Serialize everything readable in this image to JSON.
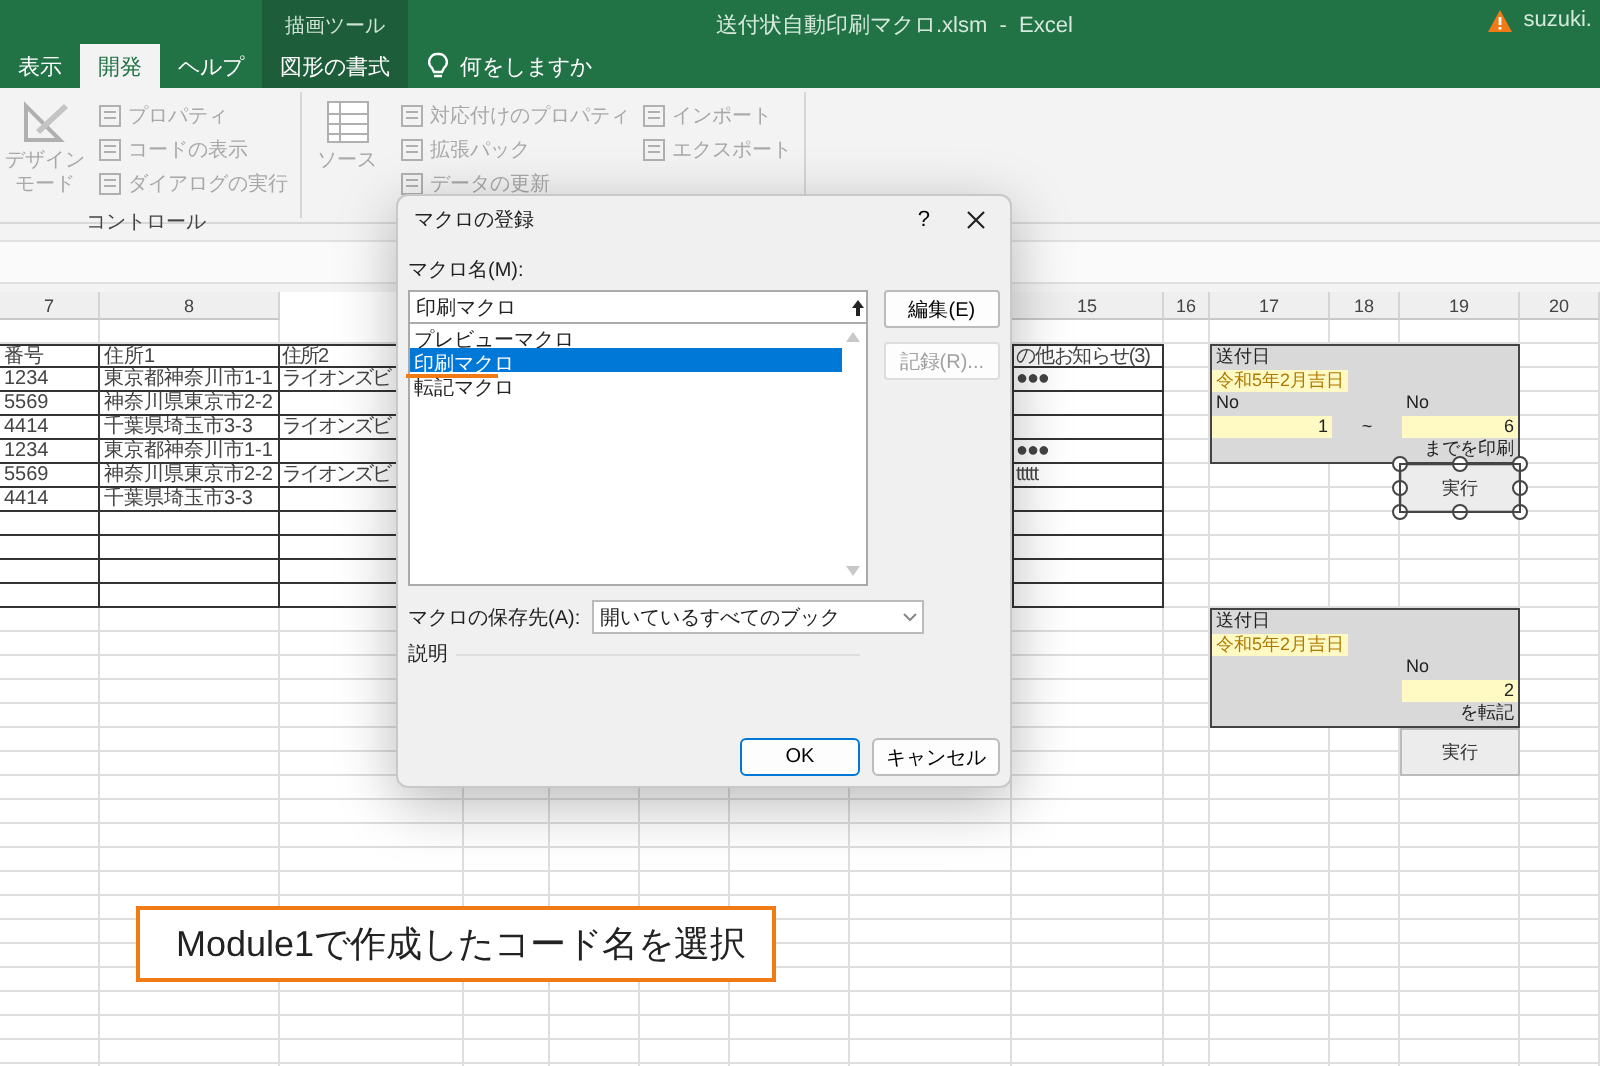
{
  "title_bar": {
    "contextual_group": "描画ツール",
    "title": "送付状自動印刷マクロ.xlsm  -  Excel",
    "account": "suzuki."
  },
  "tabs": [
    {
      "label": "表示",
      "selected": false,
      "contextual": false
    },
    {
      "label": "開発",
      "selected": true,
      "contextual": false
    },
    {
      "label": "ヘルプ",
      "selected": false,
      "contextual": false
    },
    {
      "label": "図形の書式",
      "selected": false,
      "contextual": true
    }
  ],
  "tell_me": "何をしますか",
  "ribbon_groups": [
    {
      "label": "コントロール",
      "items": [
        {
          "kind": "large",
          "label": "デザインモード",
          "disabled": true
        },
        {
          "kind": "small",
          "label": "プロパティ",
          "disabled": true
        },
        {
          "kind": "small",
          "label": "コードの表示",
          "disabled": true
        },
        {
          "kind": "small",
          "label": "ダイアログの実行",
          "disabled": true
        }
      ]
    },
    {
      "items": [
        {
          "kind": "large",
          "label": "ソース",
          "disabled": true
        },
        {
          "kind": "small",
          "label": "対応付けのプロパティ",
          "disabled": true
        },
        {
          "kind": "small",
          "label": "拡張パック",
          "disabled": true
        },
        {
          "kind": "small",
          "label": "データの更新",
          "disabled": true
        },
        {
          "kind": "small",
          "label": "インポート",
          "disabled": true
        },
        {
          "kind": "small",
          "label": "エクスポート",
          "disabled": true
        }
      ]
    }
  ],
  "sheet": {
    "column_headers": [
      "7",
      "8",
      "15",
      "16",
      "17",
      "18",
      "19",
      "20"
    ],
    "rows": [
      {
        "column_7": "番号",
        "column_8": "住所1",
        "column_9": "住所2",
        "column_15": "の他お知らせ(3)"
      },
      {
        "column_7": "1234",
        "column_8": "東京都神奈川市1-1",
        "column_9": "ライオンズビ",
        "column_15": "●●●"
      },
      {
        "column_7": "5569",
        "column_8": "神奈川県東京市2-2"
      },
      {
        "column_7": "4414",
        "column_8": "千葉県埼玉市3-3",
        "column_9": "ライオンズビ"
      },
      {
        "column_7": "1234",
        "column_8": "東京都神奈川市1-1",
        "column_15": "●●●"
      },
      {
        "column_7": "5569",
        "column_8": "神奈川県東京市2-2",
        "column_9": "ライオンズビ",
        "column_15": "ttttt"
      },
      {
        "column_7": "4414",
        "column_8": "千葉県埼玉市3-3"
      }
    ],
    "panels": [
      {
        "label": "送付日",
        "date": "令和5年2月吉日",
        "fields": [
          {
            "label": "No",
            "value": "1"
          },
          {
            "label": "No",
            "value": "6"
          }
        ],
        "separator": "~",
        "caption": "までを印刷",
        "button": {
          "label": "実行",
          "selected": true
        }
      },
      {
        "label": "送付日",
        "date": "令和5年2月吉日",
        "fields": [
          {
            "label": "No",
            "value": "2"
          }
        ],
        "caption": "を転記",
        "button": {
          "label": "実行",
          "selected": false
        }
      }
    ]
  },
  "dialog": {
    "title": "マクロの登録",
    "help": "?",
    "macro_name_label": "マクロ名(M):",
    "macro_name": "印刷マクロ",
    "macros": [
      {
        "label": "プレビューマクロ",
        "selected": false
      },
      {
        "label": "印刷マクロ",
        "selected": true
      },
      {
        "label": "転記マクロ",
        "selected": false
      }
    ],
    "side_buttons": [
      {
        "label": "編集(E)",
        "disabled": false
      },
      {
        "label": "記録(R)...",
        "disabled": true
      }
    ],
    "store_label": "マクロの保存先(A):",
    "store_value": "開いているすべてのブック",
    "description_label": "説明",
    "actions": [
      {
        "label": "OK",
        "default": true
      },
      {
        "label": "キャンセル",
        "default": false
      }
    ]
  },
  "callout": "Module1で作成したコード名を選択"
}
